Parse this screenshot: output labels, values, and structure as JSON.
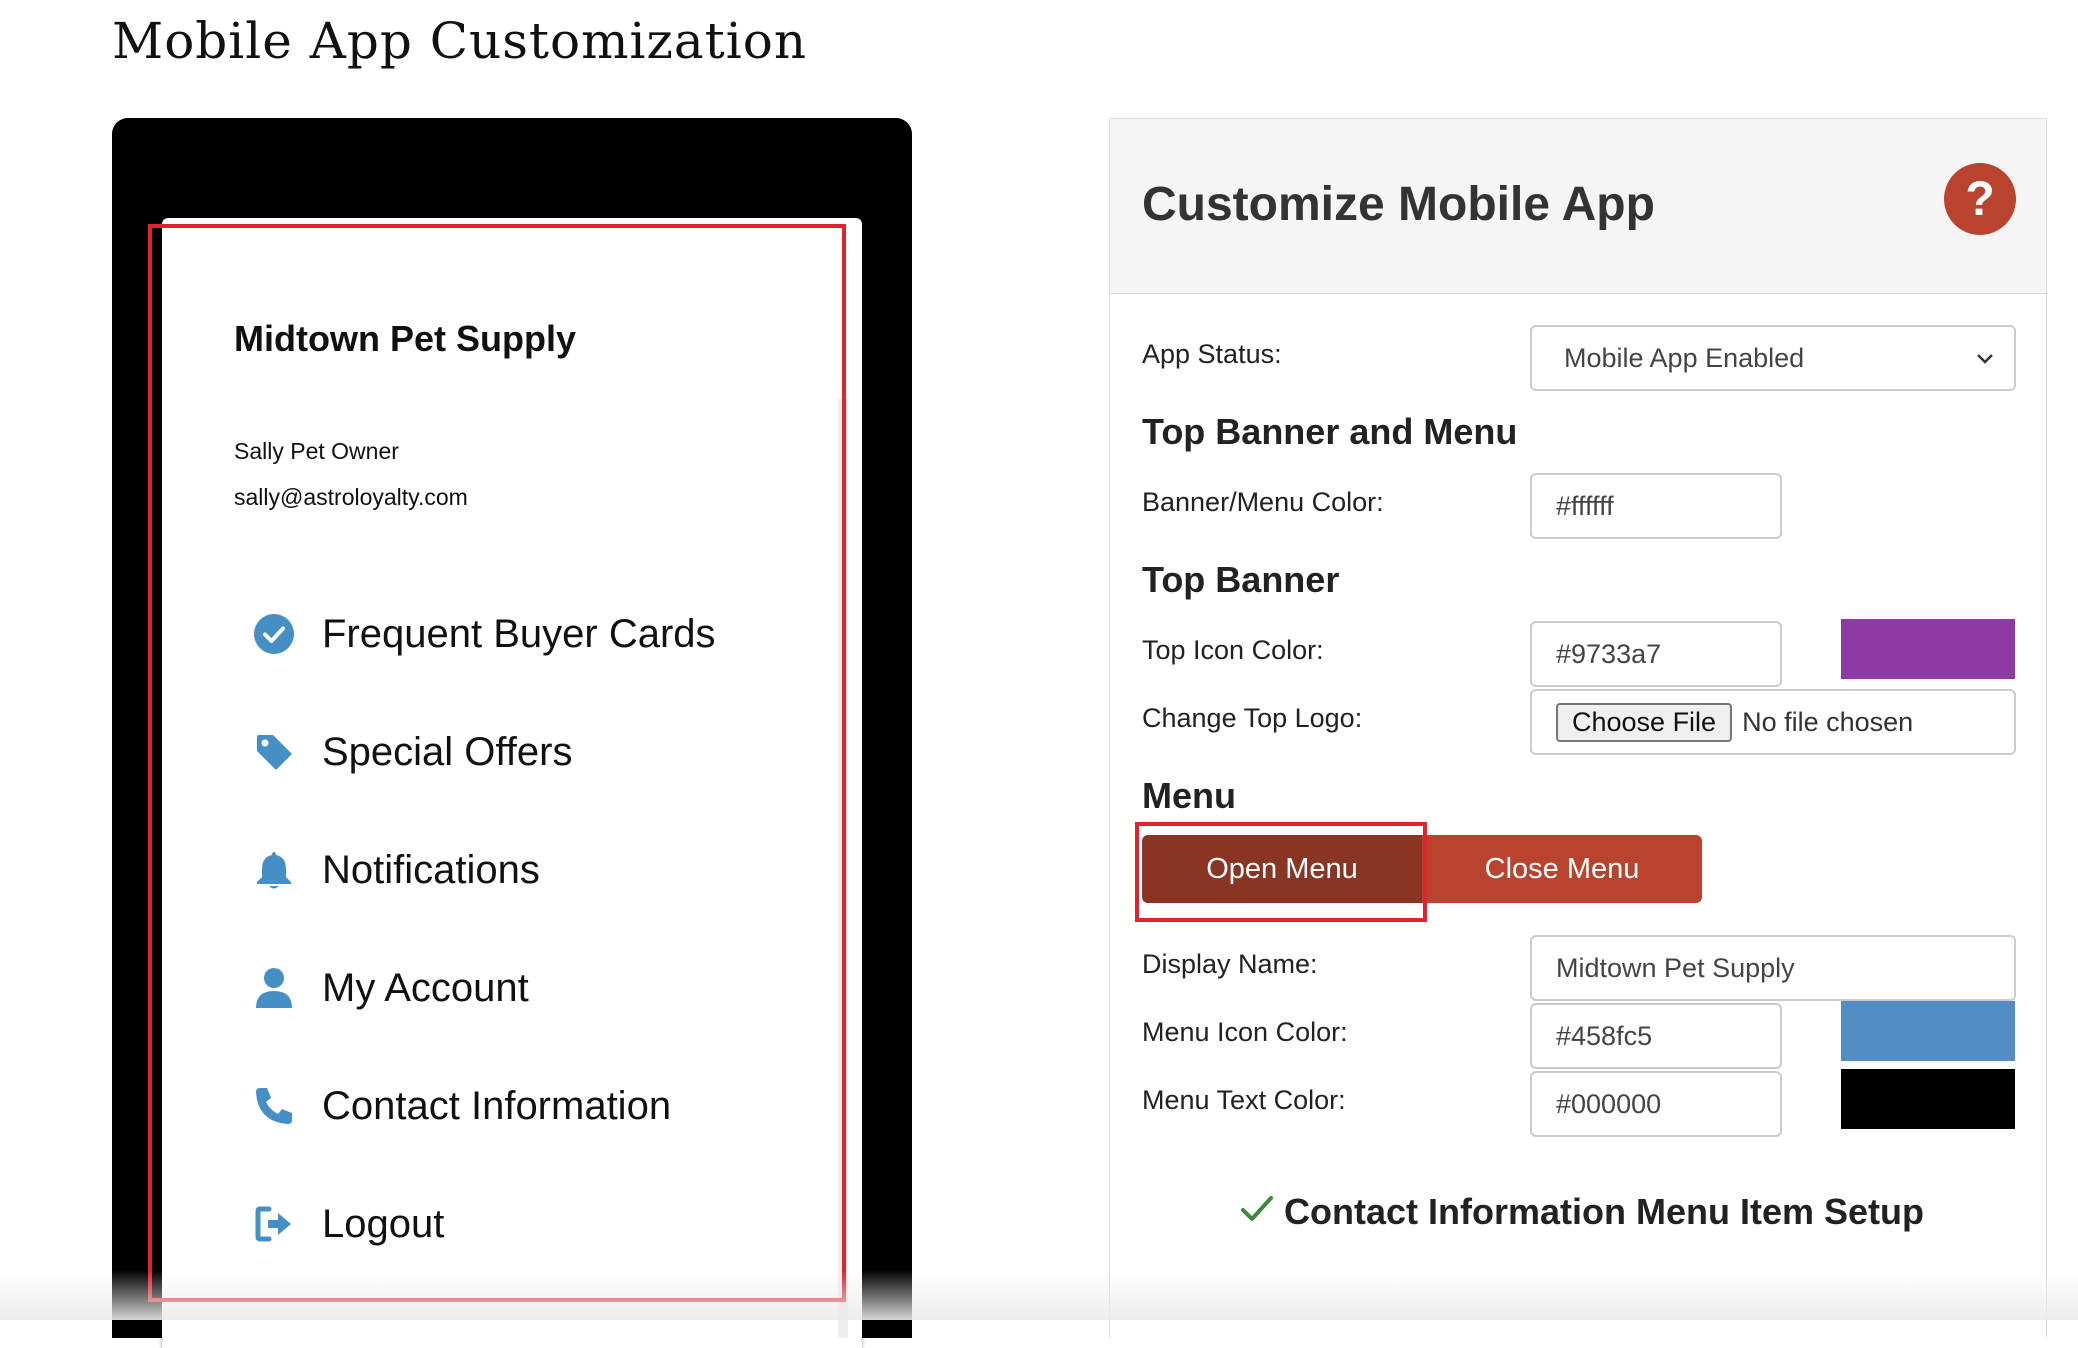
{
  "page": {
    "title": "Mobile App Customization"
  },
  "preview": {
    "display_name": "Midtown Pet Supply",
    "user_name": "Sally Pet Owner",
    "user_email": "sally@astroloyalty.com",
    "menu_items": [
      {
        "label": "Frequent Buyer Cards",
        "icon": "check-circle-icon"
      },
      {
        "label": "Special Offers",
        "icon": "tag-icon"
      },
      {
        "label": "Notifications",
        "icon": "bell-icon"
      },
      {
        "label": "My Account",
        "icon": "user-icon"
      },
      {
        "label": "Contact Information",
        "icon": "phone-icon"
      },
      {
        "label": "Logout",
        "icon": "logout-icon"
      }
    ],
    "icon_color": "#458fc5"
  },
  "panel": {
    "title": "Customize Mobile App",
    "help_label": "?",
    "app_status": {
      "label": "App Status:",
      "value": "Mobile App Enabled"
    },
    "section_top_banner_menu": "Top Banner and Menu",
    "banner_menu_color": {
      "label": "Banner/Menu Color:",
      "value": "#ffffff"
    },
    "section_top_banner": "Top Banner",
    "top_icon_color": {
      "label": "Top Icon Color:",
      "value": "#9733a7",
      "swatch": "#8e3aa6"
    },
    "change_top_logo": {
      "label": "Change Top Logo:",
      "button": "Choose File",
      "status": "No file chosen"
    },
    "section_menu": "Menu",
    "open_menu_label": "Open Menu",
    "close_menu_label": "Close Menu",
    "display_name": {
      "label": "Display Name:",
      "value": "Midtown Pet Supply"
    },
    "menu_icon_color": {
      "label": "Menu Icon Color:",
      "value": "#458fc5",
      "swatch": "#548cc4"
    },
    "menu_text_color": {
      "label": "Menu Text Color:",
      "value": "#000000",
      "swatch": "#000000"
    },
    "contact_setup_label": "Contact Information Menu Item Setup"
  },
  "colors": {
    "accent": "#b8432f",
    "accent_dark": "#8a3523",
    "highlight": "#e0232d"
  }
}
